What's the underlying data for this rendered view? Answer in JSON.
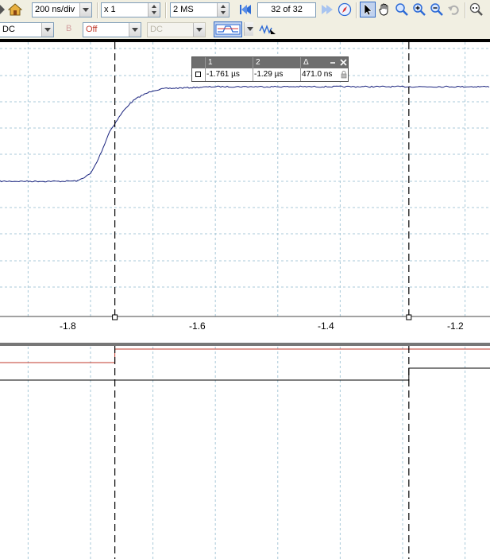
{
  "toolbar": {
    "timebase": "200 ns/div",
    "multiplier": "x 1",
    "samples": "2 MS",
    "page_current": "32",
    "page_of": "of",
    "page_total": "32"
  },
  "channel_bar": {
    "coupling_a": "DC",
    "channel_b_label": "B",
    "channel_b_state": "Off",
    "coupling_b": "DC"
  },
  "cursor_panel": {
    "col1_header": "1",
    "col2_header": "2",
    "col3_header": "Δ",
    "cursor1_value": "-1.761 µs",
    "cursor2_value": "-1.29 µs",
    "delta_value": "471.0 ns"
  },
  "axis": {
    "x_ticks": [
      "-1.8",
      "-1.6",
      "-1.4",
      "-1.2"
    ]
  },
  "chart_data": {
    "type": "line",
    "x_unit": "µs",
    "xlim": [
      -1.945,
      -1.16
    ],
    "x_ticks": [
      -1.8,
      -1.6,
      -1.4,
      -1.2
    ],
    "grid": true,
    "cursors": [
      -1.761,
      -1.29
    ],
    "series": [
      {
        "values_x": [
          -1.945,
          -1.9,
          -1.85,
          -1.82,
          -1.8,
          -1.79,
          -1.78,
          -1.77,
          -1.76,
          -1.75,
          -1.74,
          -1.73,
          -1.72,
          -1.71,
          -1.7,
          -1.68,
          -1.6,
          -1.4,
          -1.2,
          -1.16
        ],
        "values_y": [
          0.0,
          0.0,
          0.0,
          0.005,
          0.08,
          0.2,
          0.35,
          0.52,
          0.62,
          0.72,
          0.8,
          0.86,
          0.9,
          0.93,
          0.96,
          0.98,
          1.0,
          1.0,
          1.0,
          1.0
        ],
        "color": "#1a237e"
      }
    ],
    "digital_lines": [
      {
        "color": "#c0392b",
        "low_until": -1.761,
        "state": "low_then_high"
      },
      {
        "color": "#000000",
        "low_until": -1.29,
        "state": "low_then_high"
      }
    ]
  },
  "colors": {
    "trace": "#1a237e",
    "grid": "#a8c8d8",
    "toolbar_bg": "#f1efe2",
    "selected_tool": "#c1d2ee"
  }
}
